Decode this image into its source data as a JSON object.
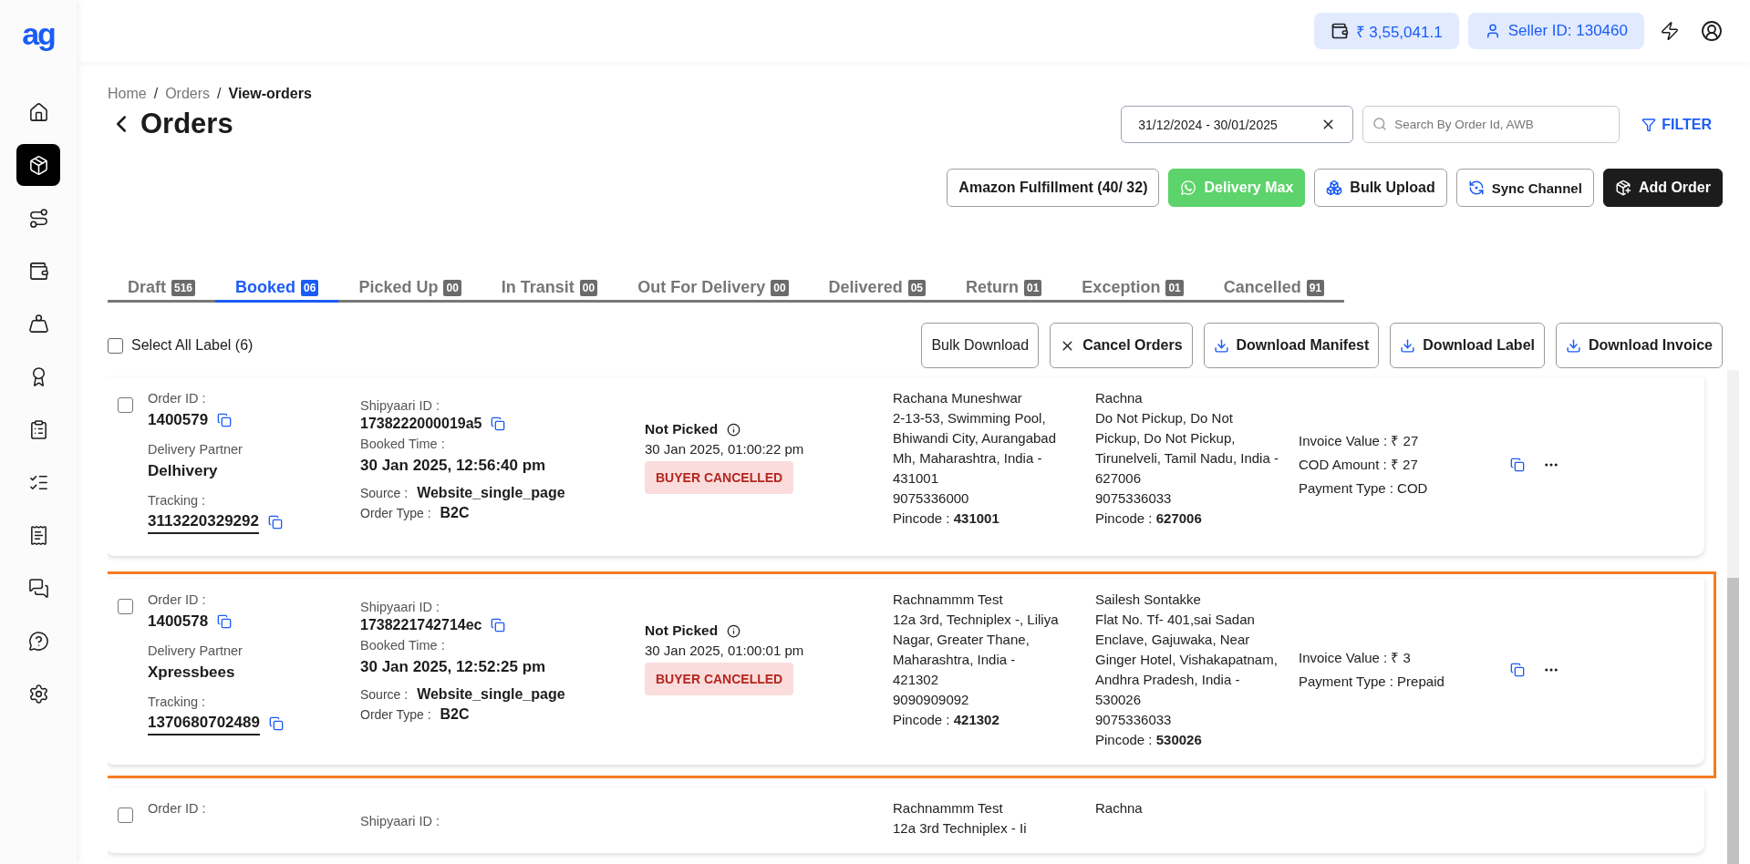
{
  "logo": "ag",
  "sidebar": {
    "items": [
      {
        "selected": false
      },
      {
        "selected": true
      },
      {
        "selected": false
      },
      {
        "selected": false
      },
      {
        "selected": false
      },
      {
        "selected": false
      },
      {
        "selected": false
      },
      {
        "selected": false
      },
      {
        "selected": false
      },
      {
        "selected": false
      },
      {
        "selected": false
      },
      {
        "selected": false
      }
    ]
  },
  "header": {
    "wallet": "₹ 3,55,041.1",
    "seller": "Seller ID: 130460"
  },
  "breadcrumb_separator": "/",
  "breadcrumb": [
    {
      "label": "Home",
      "current": false
    },
    {
      "label": "Orders",
      "current": false
    },
    {
      "label": "View-orders",
      "current": true
    }
  ],
  "title": "Orders",
  "date_range": "31/12/2024 - 30/01/2025",
  "search": {
    "placeholder": "Search By Order Id, AWB"
  },
  "filter": "FILTER",
  "top_buttons": [
    {
      "label": "Amazon Fulfillment (40/ 32)",
      "kind": "outline"
    },
    {
      "label": "Delivery Max",
      "kind": "whatsapp"
    },
    {
      "label": "Bulk Upload",
      "kind": "upload"
    },
    {
      "label": "Sync Channel",
      "kind": "sync"
    },
    {
      "label": "Add Order",
      "kind": "dark"
    }
  ],
  "tabs": [
    {
      "label": "Draft",
      "count": "516",
      "selected": false
    },
    {
      "label": "Booked",
      "count": "06",
      "selected": true
    },
    {
      "label": "Picked Up",
      "count": "00",
      "selected": false
    },
    {
      "label": "In Transit",
      "count": "00",
      "selected": false
    },
    {
      "label": "Out For Delivery",
      "count": "00",
      "selected": false
    },
    {
      "label": "Delivered",
      "count": "05",
      "selected": false
    },
    {
      "label": "Return",
      "count": "01",
      "selected": false
    },
    {
      "label": "Exception",
      "count": "01",
      "selected": false
    },
    {
      "label": "Cancelled",
      "count": "91",
      "selected": false
    }
  ],
  "select_all": {
    "label": "Select All Label (6)",
    "checked": false
  },
  "actions": [
    {
      "label": "Bulk Download",
      "kind": "plain"
    },
    {
      "label": "Cancel Orders",
      "kind": "cancel"
    },
    {
      "label": "Download Manifest",
      "kind": "download"
    },
    {
      "label": "Download Label",
      "kind": "download"
    },
    {
      "label": "Download Invoice",
      "kind": "download"
    }
  ],
  "orders": [
    {
      "selected": false,
      "checked": false,
      "order_id_label": "Order ID :",
      "order_id": "1400579",
      "partner_label": "Delivery Partner",
      "partner": "Delhivery",
      "tracking_label": "Tracking :",
      "tracking": "3113220329292",
      "shipyaari_label": "Shipyaari ID :",
      "shipyaari_id": "1738222000019a5",
      "booked_label": "Booked Time :",
      "booked_time": "30 Jan 2025, 12:56:40 pm",
      "source_label": "Source :",
      "source": "Website_single_page",
      "type_label": "Order Type :",
      "order_type": "B2C",
      "status": "Not Picked",
      "status_time": "30 Jan 2025, 01:00:22 pm",
      "badge": "BUYER CANCELLED",
      "pickup": {
        "name": "Rachana Muneshwar",
        "address": "2-13-53, Swimming Pool, Bhiwandi City, Aurangabad Mh, Maharashtra, India - 431001",
        "phone": "9075336000",
        "pincode": "Pincode : **431001**"
      },
      "delivery": {
        "name": "Rachna",
        "address": "Do Not Pickup, Do Not Pickup, Do Not Pickup, Tirunelveli, Tamil Nadu, India - 627006",
        "phone": "9075336033",
        "pincode": "Pincode : **627006**"
      },
      "payment": [
        "Invoice Value : ₹ 27",
        "COD Amount : ₹ 27",
        "Payment Type : COD"
      ]
    },
    {
      "selected": true,
      "checked": false,
      "order_id_label": "Order ID :",
      "order_id": "1400578",
      "partner_label": "Delivery Partner",
      "partner": "Xpressbees",
      "tracking_label": "Tracking :",
      "tracking": "1370680702489",
      "shipyaari_label": "Shipyaari ID :",
      "shipyaari_id": "1738221742714ec",
      "booked_label": "Booked Time :",
      "booked_time": "30 Jan 2025, 12:52:25 pm",
      "source_label": "Source :",
      "source": "Website_single_page",
      "type_label": "Order Type :",
      "order_type": "B2C",
      "status": "Not Picked",
      "status_time": "30 Jan 2025, 01:00:01 pm",
      "badge": "BUYER CANCELLED",
      "pickup": {
        "name": "Rachnammm Test",
        "address": "12a 3rd, Techniplex -, Liliya Nagar, Greater Thane, Maharashtra, India - 421302",
        "phone": "9090909092",
        "pincode": "Pincode : **421302**"
      },
      "delivery": {
        "name": "Sailesh Sontakke",
        "address": "Flat No. Tf- 401,sai Sadan Enclave, Gajuwaka, Near Ginger Hotel, Vishakapatnam, Andhra Pradesh, India - 530026",
        "phone": "9075336033",
        "pincode": "Pincode : **530026**"
      },
      "payment": [
        "Invoice Value : ₹ 3",
        "Payment Type : Prepaid"
      ]
    },
    {
      "selected": false,
      "checked": false,
      "order_id_label": "Order ID :",
      "shipyaari_label": "Shipyaari ID :",
      "pickup": {
        "name": "Rachnammm Test",
        "address": "12a 3rd Techniplex - Ii"
      },
      "delivery": {
        "name": "Rachna"
      }
    }
  ]
}
